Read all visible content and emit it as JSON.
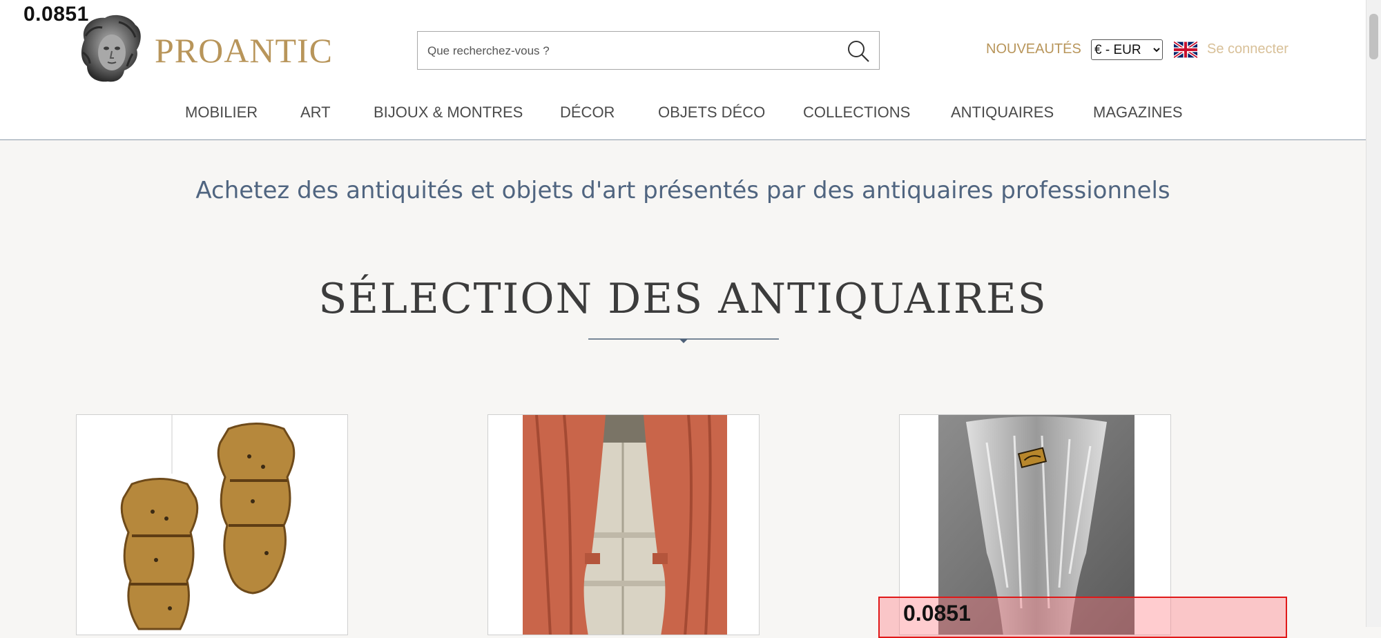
{
  "overlay_top": "0.0851",
  "overlay_bottom": "0.0851",
  "brand": {
    "name": "PROANTIC"
  },
  "search": {
    "placeholder": "Que recherchez-vous ?"
  },
  "header": {
    "nouveautes": "NOUVEAUTÉS",
    "currency_selected": "€ - EUR",
    "login": "Se connecter"
  },
  "nav": [
    "MOBILIER",
    "ART",
    "BIJOUX & MONTRES",
    "DÉCOR",
    "OBJETS DÉCO",
    "COLLECTIONS",
    "ANTIQUAIRES",
    "MAGAZINES"
  ],
  "tagline": "Achetez des antiquités et objets d'art présentés par des antiquaires professionnels",
  "section_title": "SÉLECTION DES ANTIQUAIRES",
  "icons": {
    "logo": "bust-logo-icon",
    "search": "search-icon",
    "flag": "uk-flag-icon"
  },
  "colors": {
    "brand_gold": "#b8955a",
    "tagline_blue": "#506580",
    "background": "#f7f6f4"
  }
}
